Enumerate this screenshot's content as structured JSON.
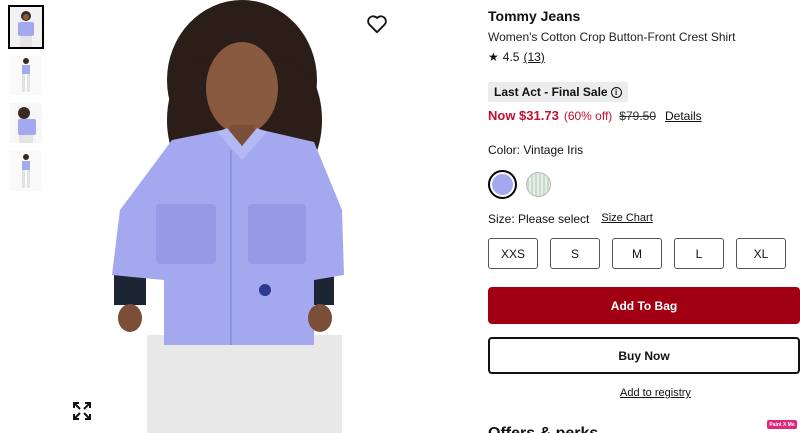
{
  "product": {
    "brand": "Tommy Jeans",
    "name": "Women's Cotton Crop Button-Front Crest Shirt",
    "rating": "4.5",
    "review_count": "(13)",
    "badge": "Last Act - Final Sale",
    "price_now": "Now $31.73",
    "discount": "(60% off)",
    "price_was": "$79.50",
    "details_link": "Details"
  },
  "color": {
    "label": "Color: Vintage Iris",
    "swatches": [
      {
        "name": "Vintage Iris",
        "hex": "#a4a8ef",
        "selected": true
      },
      {
        "name": "Green stripe",
        "hex": "#c9dccc",
        "selected": false
      }
    ]
  },
  "size": {
    "label": "Size: Please select",
    "chart_link": "Size Chart",
    "options": [
      "XXS",
      "S",
      "M",
      "L",
      "XL"
    ]
  },
  "actions": {
    "add_to_bag": "Add To Bag",
    "buy_now": "Buy Now",
    "registry": "Add to registry"
  },
  "offers_heading": "Offers & perks",
  "extension_badge": "Paint X Me",
  "icons": {
    "wishlist": "heart-icon",
    "expand": "expand-icon",
    "rating": "star-icon",
    "badge_info": "info-icon"
  },
  "colors": {
    "sale_red": "#c5112e",
    "bag_button": "#a00012",
    "shirt": "#a4a8ef"
  }
}
